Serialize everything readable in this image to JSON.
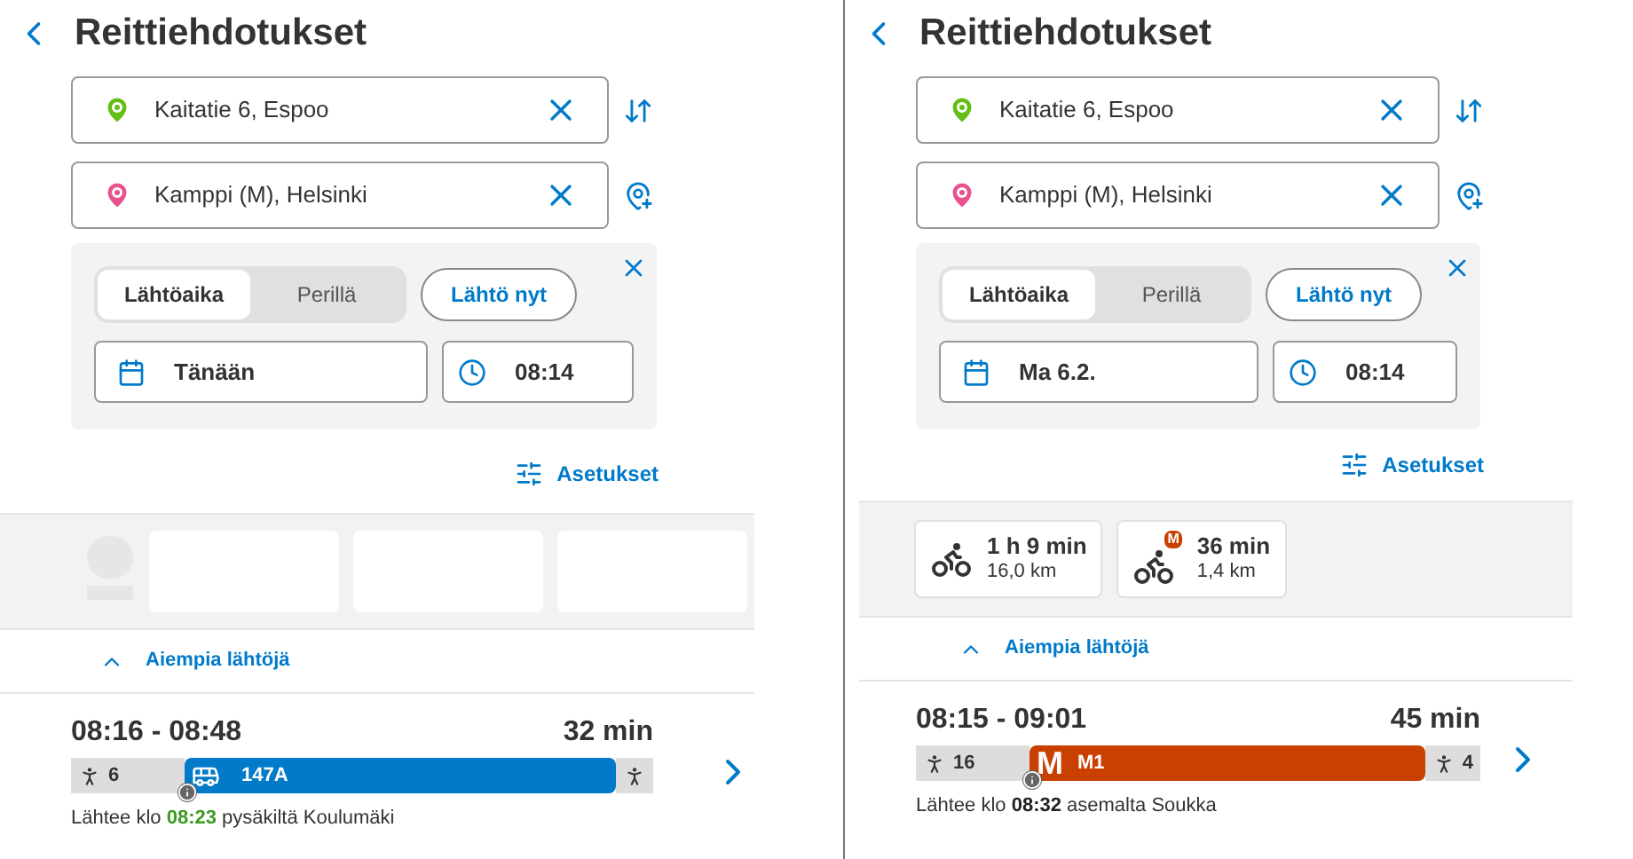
{
  "panels": [
    {
      "title": "Reittiehdotukset",
      "origin": {
        "value": "Kaitatie 6, Espoo"
      },
      "destination": {
        "value": "Kamppi (M), Helsinki"
      },
      "time_modes": [
        {
          "label": "Lähtöaika",
          "selected": true
        },
        {
          "label": "Perillä",
          "selected": false
        }
      ],
      "now_button": "Lähtö nyt",
      "date": {
        "value": "Tänään"
      },
      "time": {
        "value": "08:14"
      },
      "settings_link": "Asetukset",
      "band": {
        "kind": "loading"
      },
      "earlier_link": "Aiempia lähtöjä",
      "itinerary": {
        "times": "08:16 - 08:48",
        "duration": "32 min",
        "legs": [
          {
            "kind": "walk",
            "label": "6"
          },
          {
            "kind": "bus",
            "label": "147A"
          },
          {
            "kind": "walk"
          }
        ],
        "departure": "Lähtee klo **08:23** pysäkiltä Koulumäki",
        "color": "#3d9b20"
      }
    },
    {
      "title": "Reittiehdotukset",
      "origin": {
        "value": "Kaitatie 6, Espoo"
      },
      "destination": {
        "value": "Kamppi (M), Helsinki"
      },
      "time_modes": [
        {
          "label": "Lähtöaika",
          "selected": true
        },
        {
          "label": "Perillä",
          "selected": false
        }
      ],
      "now_button": "Lähtö nyt",
      "date": {
        "value": "Ma 6.2."
      },
      "time": {
        "value": "08:14"
      },
      "settings_link": "Asetukset",
      "band": {
        "kind": "options",
        "options": [
          {
            "kind": "bike",
            "duration": "1 h 9 min",
            "distance": "16,0 km"
          },
          {
            "kind": "bike_metro",
            "badge": "M",
            "duration": "36 min",
            "distance": "1,4 km"
          }
        ]
      },
      "earlier_link": "Aiempia lähtöjä",
      "itinerary": {
        "times": "08:15 - 09:01",
        "duration": "45 min",
        "legs": [
          {
            "kind": "walk",
            "label": "16"
          },
          {
            "kind": "metro",
            "badge": "M",
            "label": "M1"
          },
          {
            "kind": "walk",
            "label": "4"
          }
        ],
        "departure": "Lähtee klo **08:32** asemalta Soukka",
        "color": "#222222"
      }
    }
  ]
}
